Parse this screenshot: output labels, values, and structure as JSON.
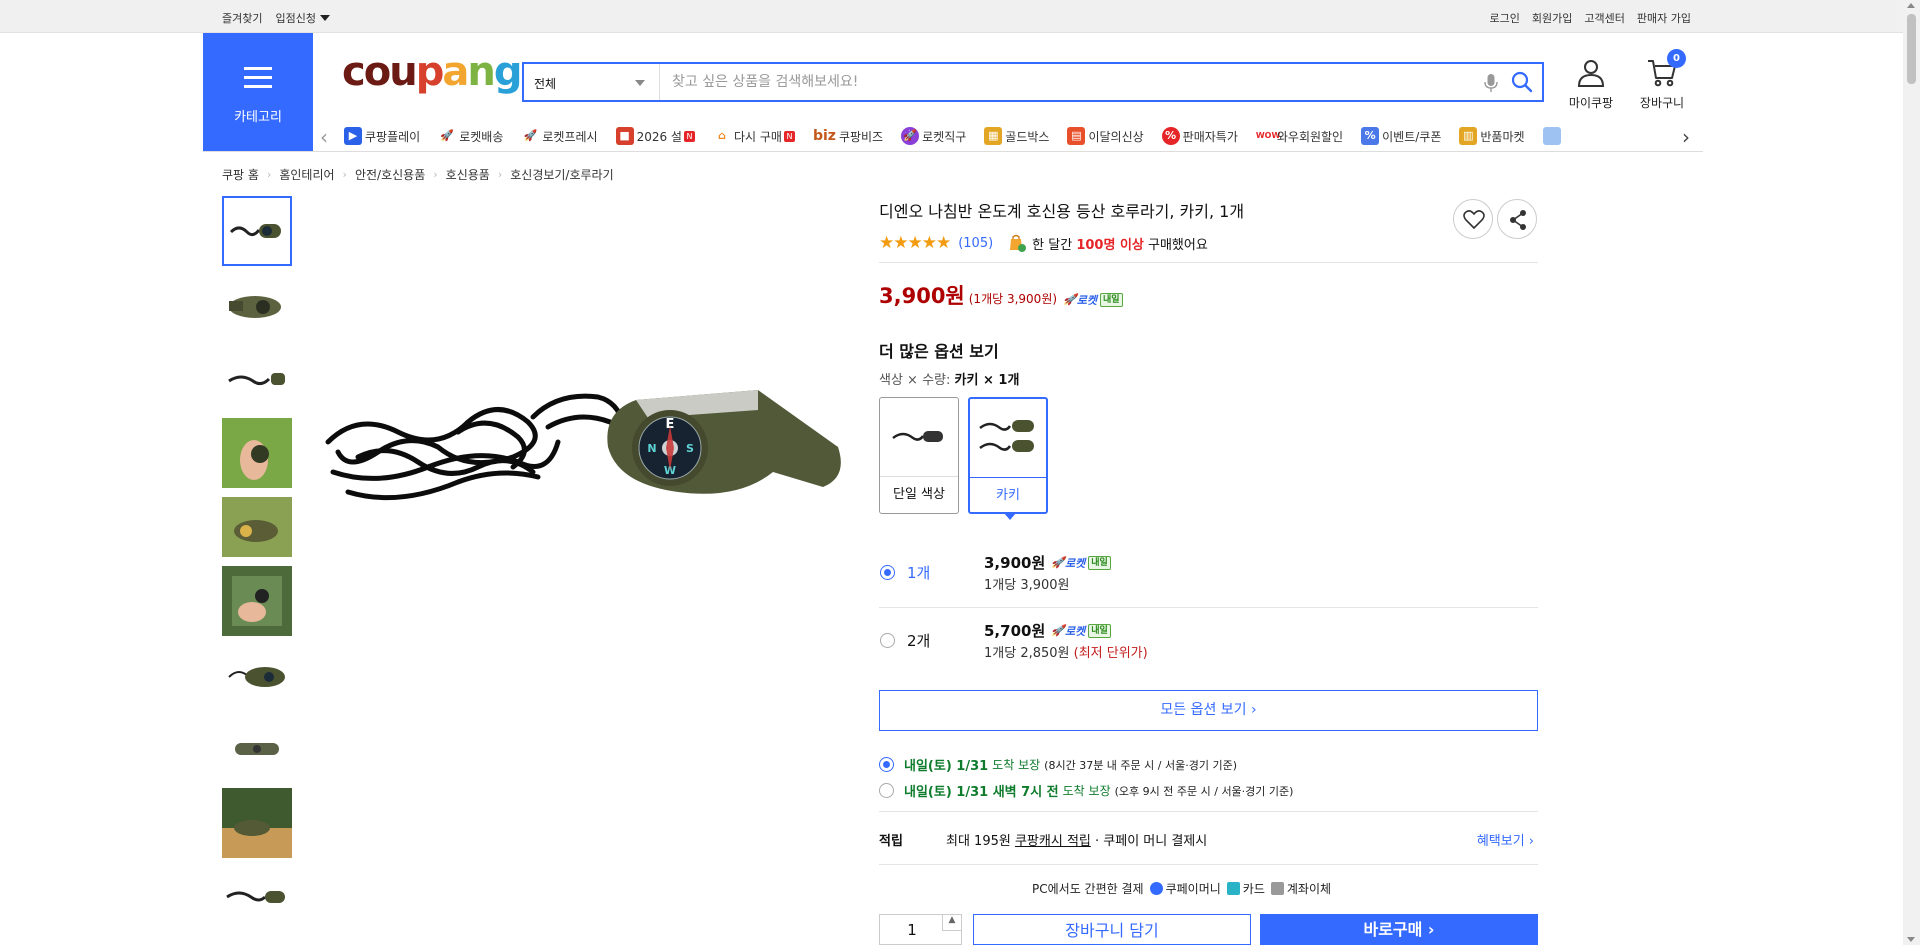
{
  "topbar": {
    "left": [
      "즐겨찾기",
      "입점신청"
    ],
    "right": [
      "로그인",
      "회원가입",
      "고객센터",
      "판매자 가입"
    ]
  },
  "category": {
    "label": "카테고리"
  },
  "logo": {
    "letters": [
      "c",
      "o",
      "u",
      "p",
      "a",
      "n",
      "g"
    ],
    "colors": [
      "#6b1a14",
      "#6b1a14",
      "#6b1a14",
      "#d6402c",
      "#f2a52f",
      "#7cb342",
      "#29a0d8"
    ]
  },
  "search": {
    "category": "전체",
    "placeholder": "찾고 싶은 상품을 검색해보세요!"
  },
  "header_icons": {
    "mypage": "마이쿠팡",
    "cart": "장바구니",
    "cart_count": "0"
  },
  "nav": [
    {
      "label": "쿠팡플레이",
      "icon": "play-icon",
      "color": "#2b61e8",
      "badge": ""
    },
    {
      "label": "로켓배송",
      "icon": "rocket-icon",
      "color": "#2b61e8",
      "badge": ""
    },
    {
      "label": "로켓프레시",
      "icon": "rocket-fresh-icon",
      "color": "#3fa34d",
      "badge": ""
    },
    {
      "label": "2026 설",
      "icon": "gift-icon",
      "color": "#d6402c",
      "badge": "N"
    },
    {
      "label": "다시 구매",
      "icon": "house-icon",
      "color": "#f08a24",
      "badge": "N"
    },
    {
      "label": "쿠팡비즈",
      "icon": "biz-icon",
      "color": "#c4581a",
      "badge": ""
    },
    {
      "label": "로켓직구",
      "icon": "globe-icon",
      "color": "#8a3fd6",
      "badge": ""
    },
    {
      "label": "골드박스",
      "icon": "goldbox-icon",
      "color": "#e2a624",
      "badge": ""
    },
    {
      "label": "이달의신상",
      "icon": "new-bag-icon",
      "color": "#e8502b",
      "badge": ""
    },
    {
      "label": "판매자특가",
      "icon": "percent-icon",
      "color": "#e52528",
      "badge": ""
    },
    {
      "label": "와우회원할인",
      "icon": "wow-icon",
      "color": "#e52528",
      "badge": ""
    },
    {
      "label": "이벤트/쿠폰",
      "icon": "coupon-icon",
      "color": "#4a78e8",
      "badge": ""
    },
    {
      "label": "반품마켓",
      "icon": "market-icon",
      "color": "#e2a624",
      "badge": ""
    }
  ],
  "breadcrumb": [
    "쿠팡 홈",
    "홈인테리어",
    "안전/호신용품",
    "호신용품",
    "호신경보기/호루라기"
  ],
  "product": {
    "title": "디엔오 나침반 온도계 호신용 등산 호루라기, 카키, 1개",
    "rating_stars": "★★★★★",
    "review_count": "(105)",
    "bought_prefix": "한 달간",
    "bought_highlight": "100명 이상",
    "bought_suffix": "구매했어요",
    "price": "3,900원",
    "unit_price": "(1개당 3,900원)",
    "rocket_label": "로켓",
    "rocket_tag": "내일"
  },
  "options": {
    "heading": "더 많은 옵션 보기",
    "summary_label": "색상 × 수량:",
    "summary_value": "카키 × 1개",
    "swatches": [
      {
        "label": "단일 색상",
        "selected": false
      },
      {
        "label": "카키",
        "selected": true
      }
    ],
    "quantities": [
      {
        "qty": "1개",
        "price": "3,900원",
        "sub": "1개당 3,900원",
        "note": "",
        "selected": true
      },
      {
        "qty": "2개",
        "price": "5,700원",
        "sub": "1개당 2,850원",
        "note": "(최저 단위가)",
        "selected": false
      }
    ],
    "all_options": "모든 옵션 보기 ›"
  },
  "delivery": [
    {
      "day": "내일(토) 1/31",
      "text": "도착 보장",
      "detail": "(8시간 37분 내 주문 시 / 서울·경기 기준)",
      "selected": true
    },
    {
      "day": "내일(토) 1/31 새벽 7시 전",
      "text": "도착 보장",
      "detail": "(오후 9시 전 주문 시 / 서울·경기 기준)",
      "selected": false
    }
  ],
  "points": {
    "label": "적립",
    "text_prefix": "최대 195원",
    "text_link": "쿠팡캐시 적립",
    "text_suffix": "· 쿠페이 머니 결제시",
    "benefit": "혜택보기 ›"
  },
  "pcpay": {
    "label": "PC에서도 간편한 결제",
    "methods": [
      "쿠페이머니",
      "카드",
      "계좌이체"
    ]
  },
  "purchase": {
    "quantity": "1",
    "cart_button": "장바구니 담기",
    "buy_button": "바로구매 ›"
  }
}
